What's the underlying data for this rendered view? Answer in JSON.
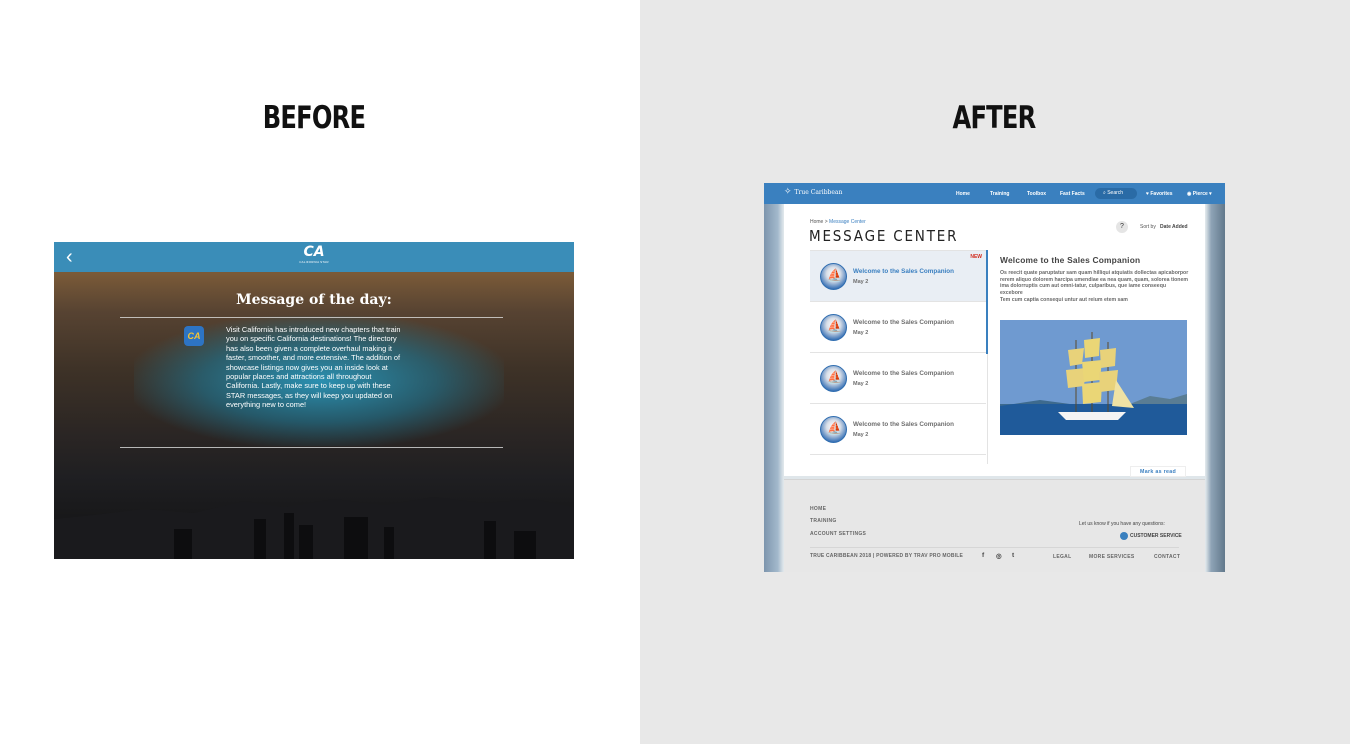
{
  "before": {
    "heading": "BEFORE",
    "app": {
      "logo_text": "CA",
      "logo_sub": "CALIFORNIA STAR",
      "back_glyph": "‹",
      "title": "Message of the day:",
      "icon_text": "CA",
      "body": "Visit California has introduced new chapters that train you on specific California destinations! The directory has also been given a complete overhaul making it faster, smoother, and more extensive. The addition of showcase listings now gives you an inside look at popular places and attractions all throughout California. Lastly, make sure to keep up with these STAR messages, as they will keep you updated on everything new to come!"
    }
  },
  "after": {
    "heading": "AFTER",
    "nav": {
      "brand": "True Caribbean",
      "items": [
        "Home",
        "Training",
        "Toolbox",
        "Fast Facts"
      ],
      "search_label": "Search",
      "favorites_label": "Favorites",
      "user_label": "Pierce"
    },
    "breadcrumb": {
      "home": "Home",
      "separator": ">",
      "current": "Message Center"
    },
    "page_title": "MESSAGE CENTER",
    "help_glyph": "?",
    "sort": {
      "label": "Sort by",
      "value": "Date Added"
    },
    "messages": [
      {
        "title": "Welcome to the Sales Companion",
        "date": "May 2",
        "badge": "NEW"
      },
      {
        "title": "Welcome to the Sales Companion",
        "date": "May 2"
      },
      {
        "title": "Welcome to the Sales Companion",
        "date": "May 2"
      },
      {
        "title": "Welcome to the Sales Companion",
        "date": "May 2"
      }
    ],
    "detail": {
      "title": "Welcome to the Sales Companion",
      "body_1": "Os reecit quate paruptatur sam quam hilliqui atquiatis dollectas apicaborpor rerem aliquo dolorem harcipa umendiae ea nea quam, quam, solorea tionem ima dolorruptis cum aut omni-tatur, culparibus, que iame conseequ excebore",
      "body_2": "Tem cum captia consequi untur aut reium etem sam",
      "mark_read": "Mark as read"
    },
    "footer": {
      "links": [
        "HOME",
        "TRAINING",
        "ACCOUNT SETTINGS"
      ],
      "question": "Let us know if you have any questions:",
      "customer_service": "CUSTOMER SERVICE",
      "copyright": "TRUE CARIBBEAN 2018  |  POWERED BY TRAV PRO MOBILE",
      "social": [
        "f",
        "◎",
        "t"
      ],
      "bottom_links": [
        "LEGAL",
        "MORE SERVICES",
        "CONTACT"
      ]
    }
  }
}
